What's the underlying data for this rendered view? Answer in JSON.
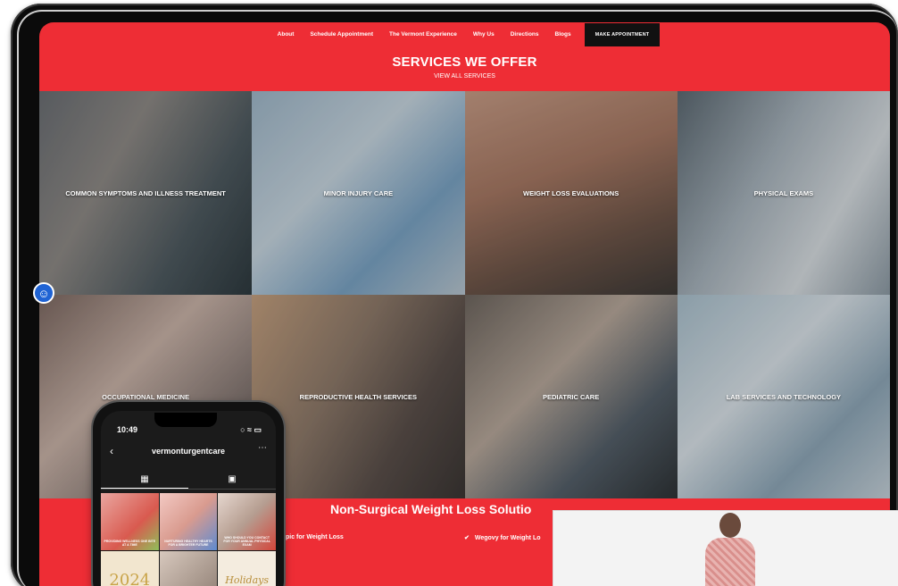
{
  "nav": {
    "items": [
      "About",
      "Schedule Appointment",
      "The Vermont Experience",
      "Why Us",
      "Directions",
      "Blogs"
    ],
    "cta": "MAKE APPOINTMENT"
  },
  "hero": {
    "title": "SERVICES WE OFFER",
    "subtitle": "VIEW ALL SERVICES"
  },
  "services": [
    "COMMON SYMPTOMS AND ILLNESS TREATMENT",
    "MINOR INJURY CARE",
    "WEIGHT LOSS EVALUATIONS",
    "PHYSICAL EXAMS",
    "OCCUPATIONAL MEDICINE",
    "REPRODUCTIVE HEALTH SERVICES",
    "PEDIATRIC CARE",
    "LAB SERVICES AND TECHNOLOGY"
  ],
  "weight_loss": {
    "title": "Non-Surgical Weight Loss Solutio",
    "items": [
      "pic for Weight Loss",
      "Wegovy for Weight Lo"
    ]
  },
  "phone": {
    "time": "10:49",
    "status_icons": "signal wifi battery",
    "account": "vermonturgentcare",
    "grid_icon": "grid-icon",
    "tagged_icon": "tagged-icon",
    "posts": [
      {
        "caption": "PROVIDING WELLNESS ONE BITE AT A TIME"
      },
      {
        "caption": "NURTURING HEALTHY HEARTS FOR A BRIGHTER FUTURE"
      },
      {
        "caption": "WHO SHOULD YOU CONTACT FOR YOUR ANNUAL PHYSICAL EXAM"
      },
      {
        "caption": "2024"
      },
      {
        "caption": ""
      },
      {
        "caption": "Holidays"
      }
    ]
  },
  "colors": {
    "brand_red": "#ee2d35",
    "nav_cta_bg": "#111111",
    "a11y_blue": "#1f63d4"
  }
}
